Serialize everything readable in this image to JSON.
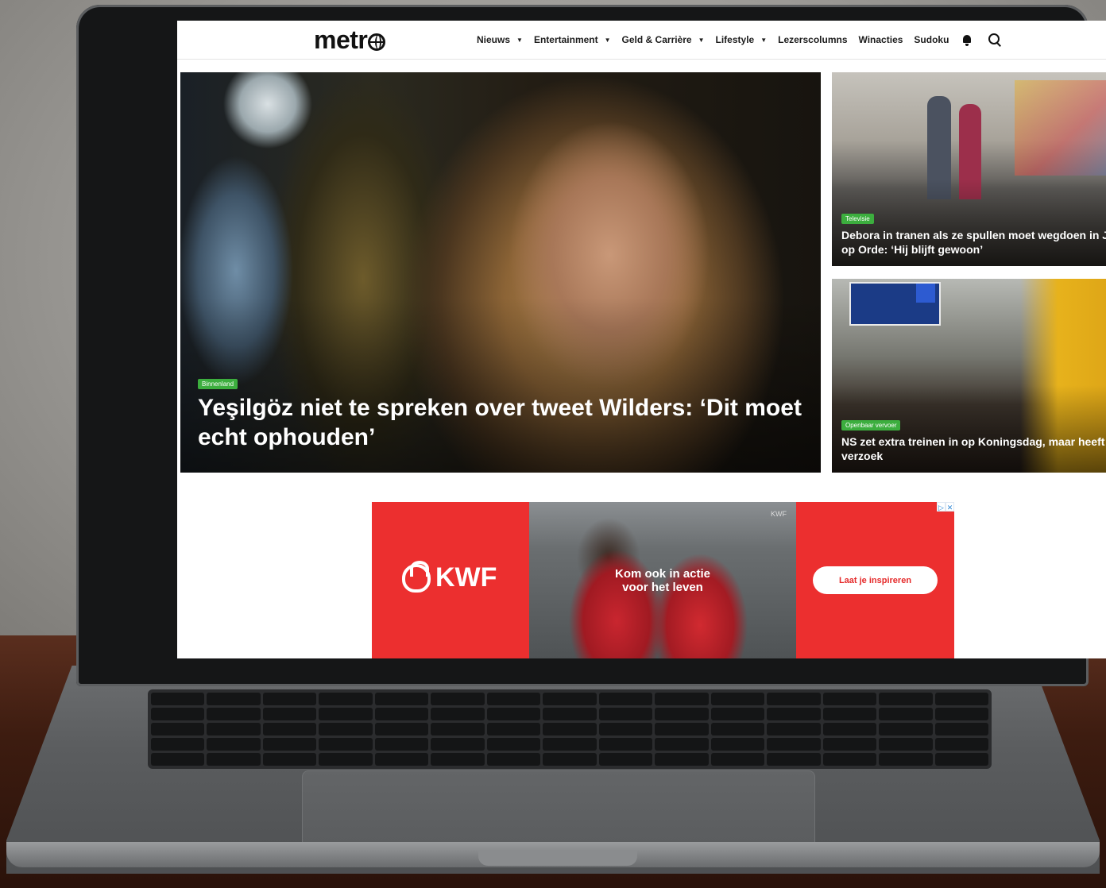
{
  "site": {
    "logo": "metr"
  },
  "nav": {
    "items": [
      {
        "label": "Nieuws",
        "dropdown": true
      },
      {
        "label": "Entertainment",
        "dropdown": true
      },
      {
        "label": "Geld & Carrière",
        "dropdown": true
      },
      {
        "label": "Lifestyle",
        "dropdown": true
      },
      {
        "label": "Lezerscolumns",
        "dropdown": false
      },
      {
        "label": "Winacties",
        "dropdown": false
      },
      {
        "label": "Sudoku",
        "dropdown": false
      }
    ],
    "icons": [
      "bell-icon",
      "search-icon"
    ]
  },
  "hero": {
    "tag": "Binnenland",
    "title": "Yeşilgöz niet te spreken over tweet Wilders: ‘Dit moet echt ophouden’"
  },
  "cards": [
    {
      "tag": "Televisie",
      "title": "Debora in tranen als ze spullen moet wegdoen in Je Huis op Orde: ‘Hij blijft gewoon’"
    },
    {
      "tag": "Openbaar vervoer",
      "title": "NS zet extra treinen in op Koningsdag, maar heeft een verzoek"
    }
  ],
  "ad": {
    "brand": "KWF",
    "headline_line1": "Kom ook in actie",
    "headline_line2": "voor het leven",
    "watermark": "KWF",
    "cta": "Laat je inspireren",
    "colors": {
      "background": "#ec2f2f",
      "cta_text": "#e52a2a"
    }
  },
  "colors": {
    "tag_green": "#3cae3e"
  }
}
